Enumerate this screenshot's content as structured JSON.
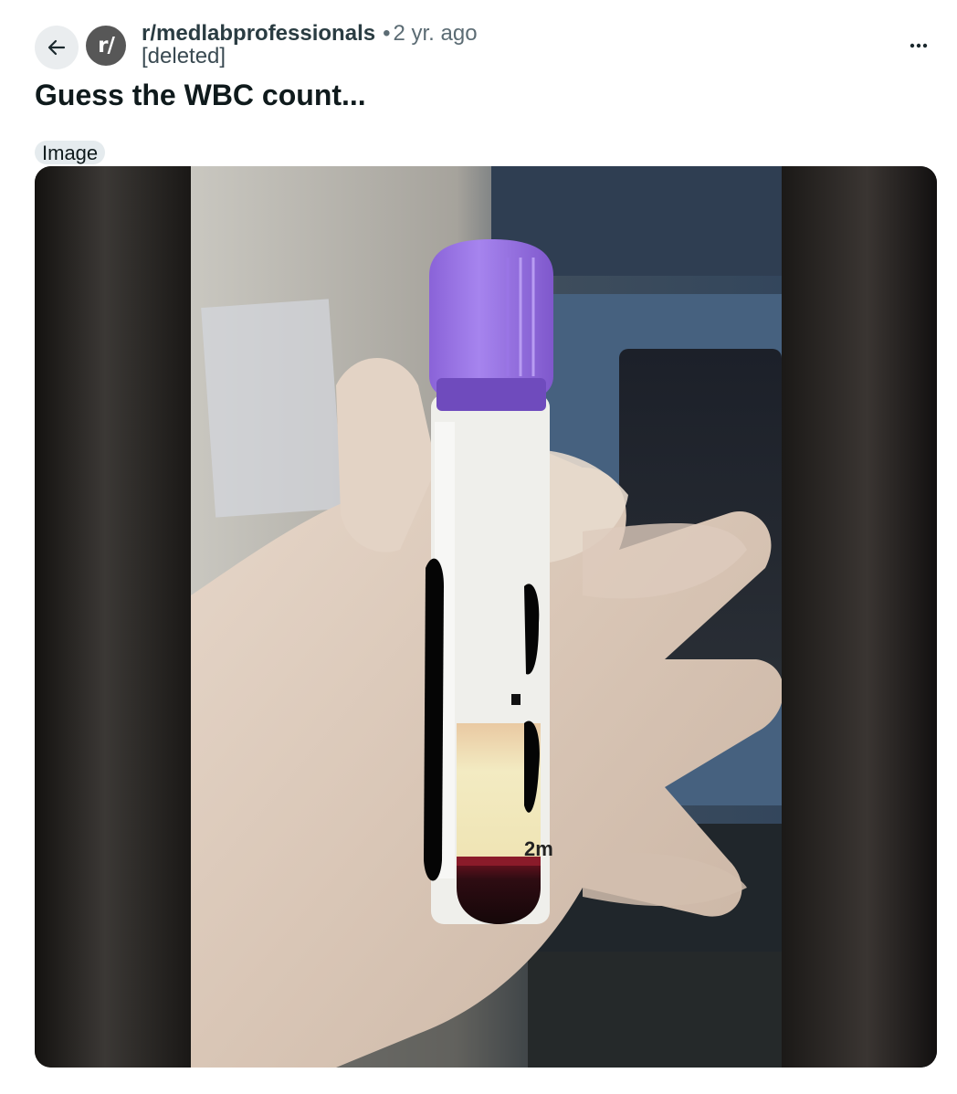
{
  "header": {
    "back_icon": "arrow-left-icon",
    "subreddit_avatar_text": "r/",
    "subreddit": "r/medlabprofessionals",
    "separator": "•",
    "time_ago": "2 yr. ago",
    "author": "[deleted]",
    "more_icon": "ellipsis-icon"
  },
  "post": {
    "title": "Guess the WBC count...",
    "flair": "Image",
    "media": {
      "kind": "photo",
      "subject_icon": "blood-tube-photo",
      "tube_label_fragment": "2m",
      "cap_color": "#9b77e6"
    }
  },
  "colors": {
    "page_background": "#ffffff",
    "back_button_bg": "#eaedef",
    "avatar_bg": "#575757",
    "subreddit_text": "#2a3c42",
    "meta_text": "#5c6c74",
    "flair_bg": "#e5ebee",
    "letterbox": "#151311"
  }
}
